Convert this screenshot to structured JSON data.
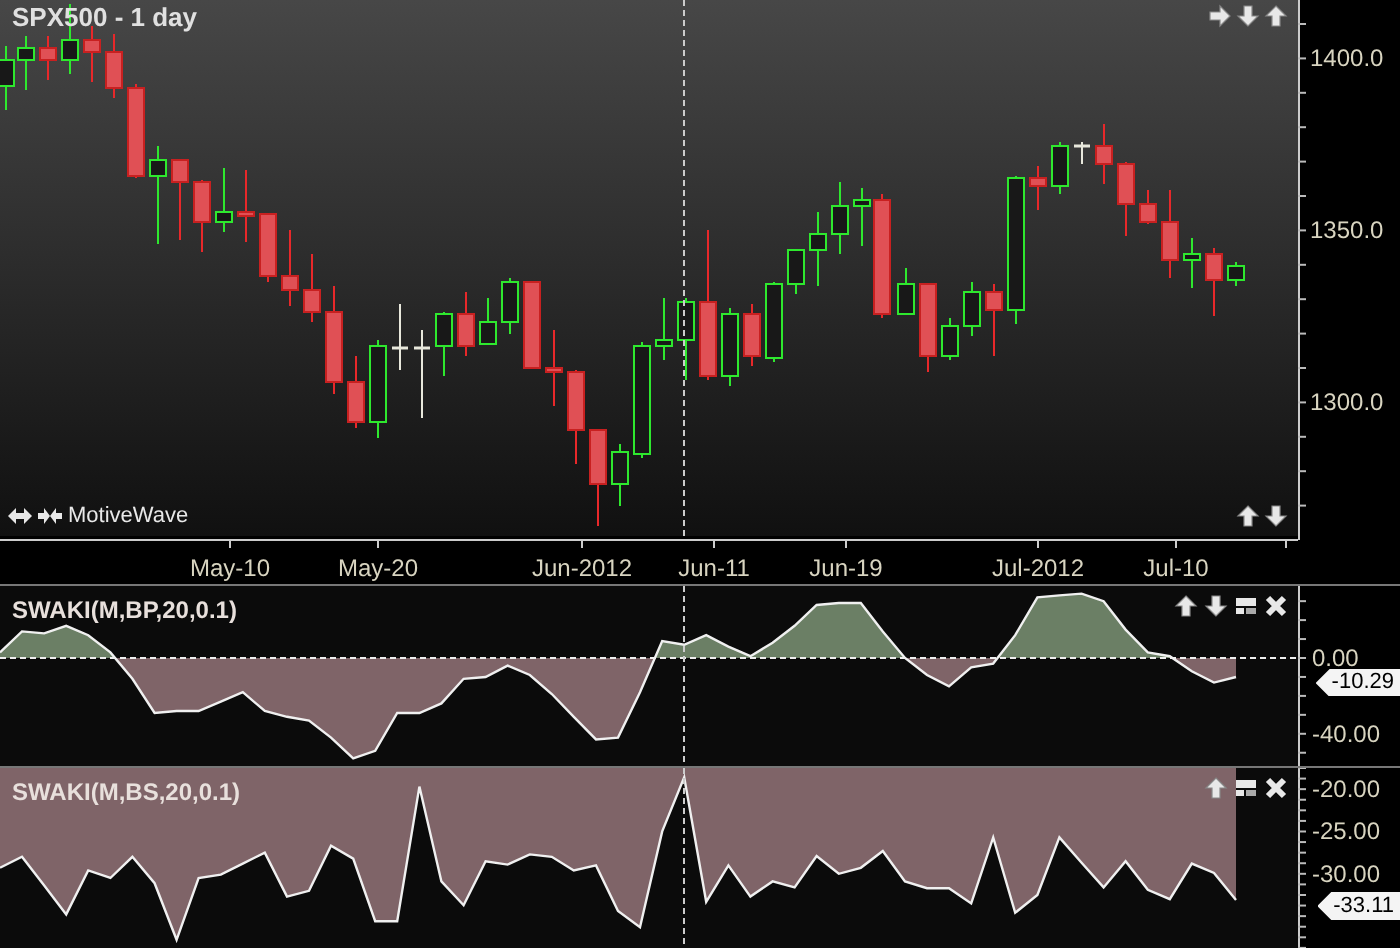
{
  "main_chart": {
    "title": "SPX500 - 1 day",
    "brand": "MotiveWave",
    "price_axis": [
      "1400.0",
      "1350.0",
      "1300.0"
    ],
    "date_axis": [
      "May-10",
      "May-20",
      "Jun-2012",
      "Jun-11",
      "Jun-19",
      "Jul-2012",
      "Jul-10"
    ]
  },
  "indicators": [
    {
      "value": "-10.29",
      "kind": "oscillator",
      "chart_data": {
        "type": "area",
        "title": "SWAKI(M,BP,20,0.1)",
        "ylim": [
          -57,
          38
        ],
        "yticks": [
          {
            "value": 0,
            "label": "0.00"
          },
          {
            "value": -40,
            "label": "-40.00"
          }
        ],
        "ref_lines": [
          {
            "axis": "y",
            "value": 0
          }
        ],
        "series": [
          {
            "values": [
              3,
              14,
              13,
              17,
              12,
              3,
              -11,
              -29,
              -28,
              -28,
              -23,
              -18,
              -28,
              -31,
              -33,
              -42,
              -53,
              -49,
              -29,
              -29,
              -24,
              -11,
              -10,
              -4,
              -9,
              -19,
              -31,
              -43,
              -42,
              -18,
              9,
              7,
              12,
              6,
              1,
              8,
              17,
              28,
              29,
              29,
              14,
              0,
              -9,
              -15,
              -5,
              -3,
              12,
              32,
              33,
              34,
              30,
              15,
              3,
              1,
              -7,
              -13,
              -10
            ]
          }
        ]
      }
    },
    {
      "value": "-33.11",
      "kind": "band",
      "chart_data": {
        "type": "area",
        "title": "SWAKI(M,BS,20,0.1)",
        "ylim": [
          -39,
          -17.5
        ],
        "yticks": [
          {
            "value": -20,
            "label": "-20.00"
          },
          {
            "value": -25,
            "label": "-25.00"
          },
          {
            "value": -30,
            "label": "-30.00"
          }
        ],
        "series": [
          {
            "values": [
              -29.3,
              -28.0,
              -31.4,
              -34.8,
              -29.6,
              -30.5,
              -28.0,
              -31.1,
              -37.8,
              -30.5,
              -30.1,
              -28.8,
              -27.5,
              -32.7,
              -32.0,
              -26.7,
              -28.2,
              -35.6,
              -35.6,
              -19.7,
              -30.9,
              -33.7,
              -28.5,
              -28.9,
              -27.7,
              -28.0,
              -29.6,
              -29.0,
              -34.4,
              -36.3,
              -25.0,
              -18.6,
              -33.3,
              -29.0,
              -32.7,
              -30.9,
              -31.6,
              -27.9,
              -30.0,
              -29.3,
              -27.3,
              -30.9,
              -31.7,
              -31.7,
              -33.5,
              -25.7,
              -34.6,
              -32.5,
              -25.7,
              -28.7,
              -31.6,
              -28.5,
              -31.9,
              -33.0,
              -28.8,
              -29.9,
              -33.1
            ]
          }
        ]
      }
    }
  ]
}
